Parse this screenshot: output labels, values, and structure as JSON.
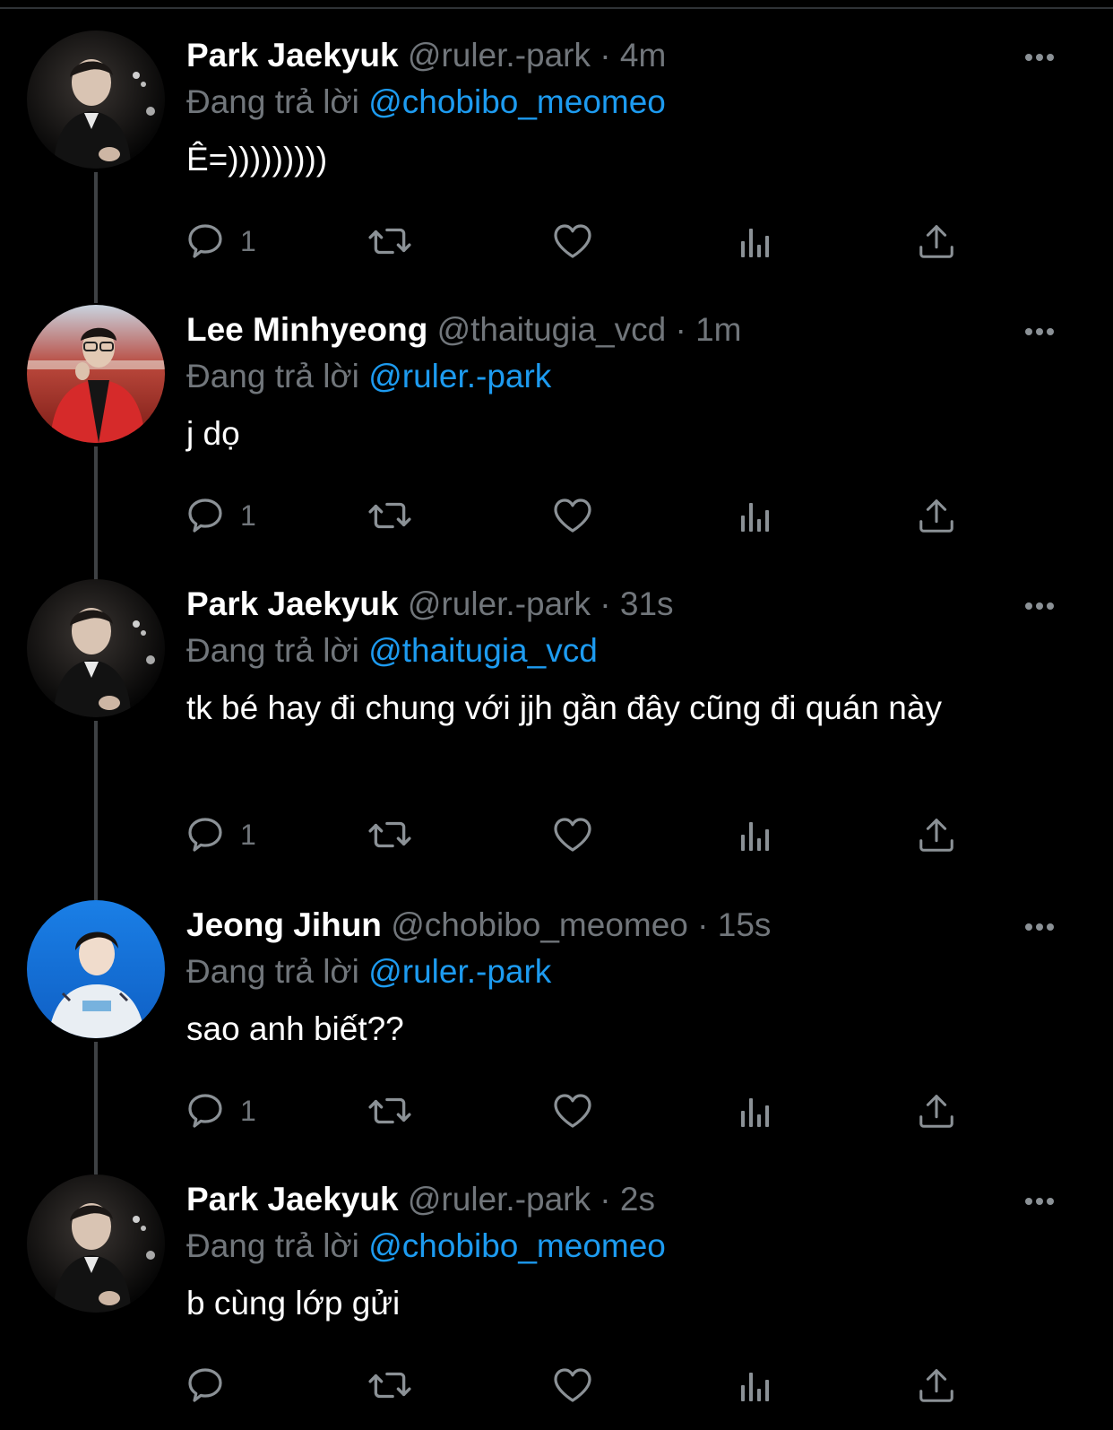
{
  "thread": {
    "reply_prefix": "Đang trả lời",
    "tweets": [
      {
        "name": "Park Jaekyuk",
        "handle": "@ruler.-park",
        "time": "· 4m",
        "reply_to": "@chobibo_meomeo",
        "text": "Ê=)))))))))",
        "reply_count": "1",
        "avatar": "dark-portrait"
      },
      {
        "name": "Lee Minhyeong",
        "handle": "@thaitugia_vcd",
        "time": "· 1m",
        "reply_to": "@ruler.-park",
        "text": "j dọ",
        "reply_count": "1",
        "avatar": "red-jacket-portrait"
      },
      {
        "name": "Park Jaekyuk",
        "handle": "@ruler.-park",
        "time": "· 31s",
        "reply_to": "@thaitugia_vcd",
        "text": "tk bé hay đi chung với jjh gần đây cũng đi quán này",
        "reply_count": "1",
        "avatar": "dark-portrait"
      },
      {
        "name": "Jeong Jihun",
        "handle": "@chobibo_meomeo",
        "time": "· 15s",
        "reply_to": "@ruler.-park",
        "text": "sao anh biết??",
        "reply_count": "1",
        "avatar": "blue-background-portrait"
      },
      {
        "name": "Park Jaekyuk",
        "handle": "@ruler.-park",
        "time": "· 2s",
        "reply_to": "@chobibo_meomeo",
        "text": "b cùng lớp gửi",
        "reply_count": "",
        "avatar": "dark-portrait"
      }
    ]
  },
  "icons": {
    "more": "more-horizontal-icon",
    "reply": "speech-bubble-icon",
    "retweet": "retweet-icon",
    "like": "heart-icon",
    "views": "bar-chart-icon",
    "share": "share-upload-icon"
  },
  "colors": {
    "background": "#000000",
    "primary_text": "#ffffff",
    "secondary_text": "#71767b",
    "mention": "#1d9bf0",
    "thread_line": "#3e4144"
  }
}
